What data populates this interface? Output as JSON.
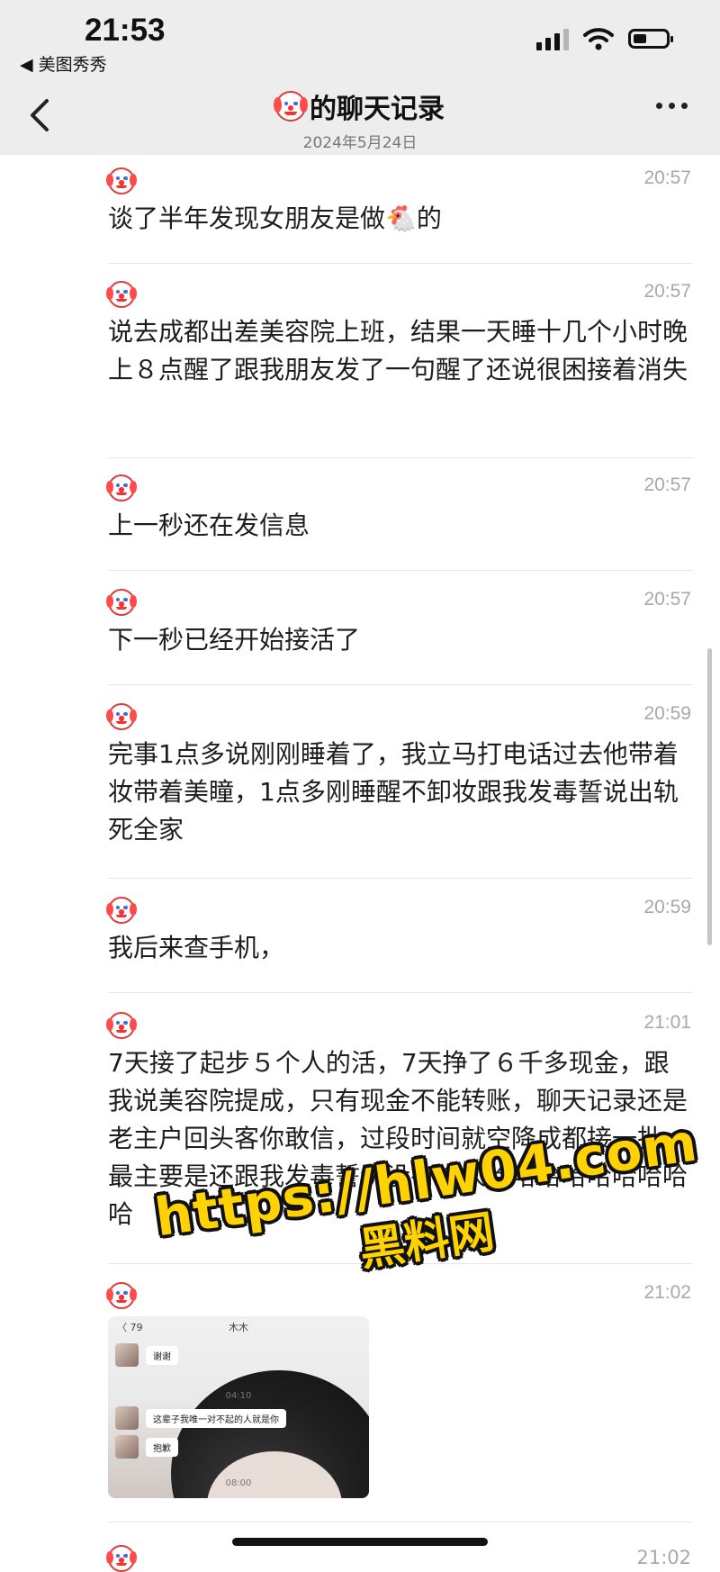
{
  "status_bar": {
    "time": "21:53",
    "back_app": "◀ 美图秀秀"
  },
  "header": {
    "title": "的聊天记录",
    "date": "2024年5月24日"
  },
  "messages": [
    {
      "time": "20:57",
      "text": "谈了半年发现女朋友是做🐔的"
    },
    {
      "time": "20:57",
      "text": "说去成都出差美容院上班，结果一天睡十几个小时晚上８点醒了跟我朋友发了一句醒了还说很困接着消失"
    },
    {
      "time": "20:57",
      "text": "上一秒还在发信息"
    },
    {
      "time": "20:57",
      "text": "下一秒已经开始接活了"
    },
    {
      "time": "20:59",
      "text": "完事1点多说刚刚睡着了，我立马打电话过去他带着妆带着美瞳，1点多刚睡醒不卸妆跟我发毒誓说出轨死全家"
    },
    {
      "time": "20:59",
      "text": "我后来查手机，"
    },
    {
      "time": "21:01",
      "text": "7天接了起步５个人的活，7天挣了６千多现金，跟我说美容院提成，只有现金不能转账，聊天记录还是老主户回头客你敢信，过段时间就空降成都接一批，最主要是还跟我发毒誓说没有偷人哈哈哈哈哈哈哈哈哈"
    },
    {
      "time": "21:02",
      "text": ""
    }
  ],
  "thumbnail": {
    "back": "〈 79",
    "name": "木木",
    "bubbles": [
      "谢谢",
      "这辈子我唯一对不起的人就是你",
      "抱歉"
    ],
    "timestamps": [
      "04:10",
      "08:00"
    ]
  },
  "watermark": {
    "url": "https://hlw04.com",
    "site": "黑料网"
  },
  "partial_next_time": "21:02"
}
